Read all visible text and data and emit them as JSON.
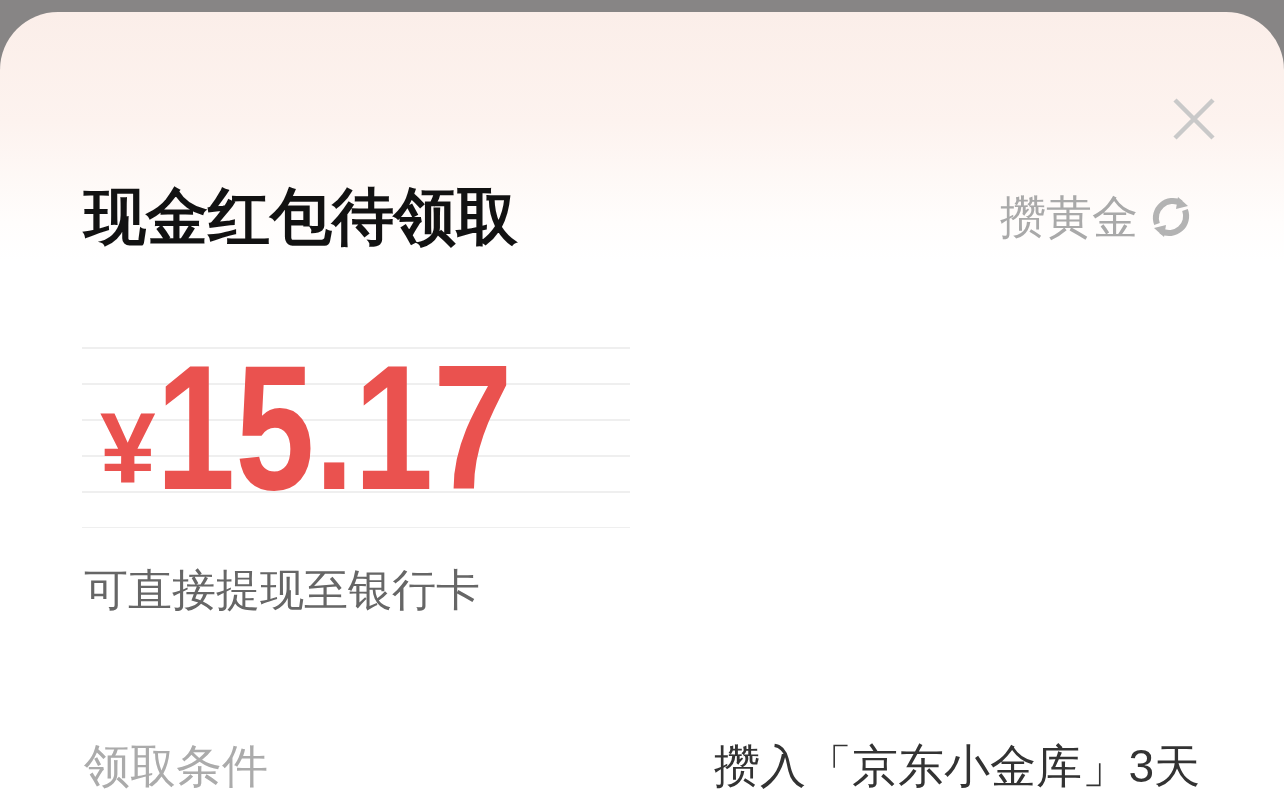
{
  "sheet": {
    "title": "现金红包待领取",
    "gold_link": {
      "label": "攒黄金"
    },
    "amount": {
      "currency": "¥",
      "value": "15.17"
    },
    "note": "可直接提现至银行卡",
    "conditions": [
      {
        "label": "领取条件",
        "value": "攒入「京东小金库」3天"
      }
    ]
  }
}
